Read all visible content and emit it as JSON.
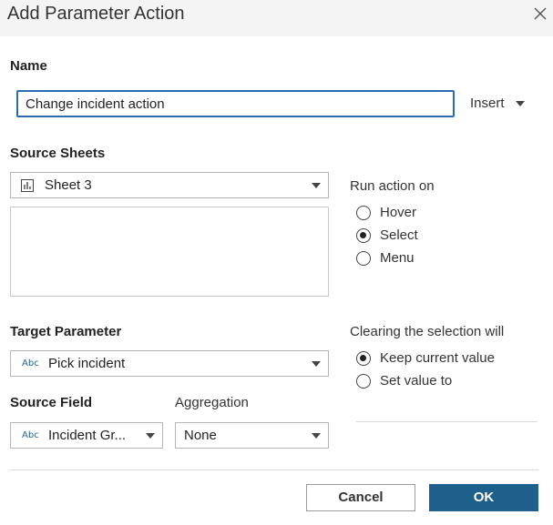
{
  "dialog": {
    "title": "Add Parameter Action",
    "close_icon": "close-icon"
  },
  "name_section": {
    "label": "Name",
    "value": "Change incident action",
    "insert_label": "Insert"
  },
  "source_sheets": {
    "label": "Source Sheets",
    "selected": "Sheet 3",
    "icon": "bar-chart-icon"
  },
  "run_action_on": {
    "label": "Run action on",
    "options": [
      {
        "label": "Hover",
        "checked": false
      },
      {
        "label": "Select",
        "checked": true
      },
      {
        "label": "Menu",
        "checked": false
      }
    ]
  },
  "target_parameter": {
    "label": "Target Parameter",
    "type_badge": "Abc",
    "selected": "Pick incident"
  },
  "clearing": {
    "label": "Clearing the selection will",
    "options": [
      {
        "label": "Keep current value",
        "checked": true
      },
      {
        "label": "Set value to",
        "checked": false
      }
    ]
  },
  "source_field": {
    "label": "Source Field",
    "type_badge": "Abc",
    "selected": "Incident Gr..."
  },
  "aggregation": {
    "label": "Aggregation",
    "selected": "None"
  },
  "footer": {
    "cancel_label": "Cancel",
    "ok_label": "OK"
  },
  "colors": {
    "primary": "#1f5f8b",
    "focus_border": "#2b6cb0",
    "titlebar_bg": "#f4f4f4"
  }
}
